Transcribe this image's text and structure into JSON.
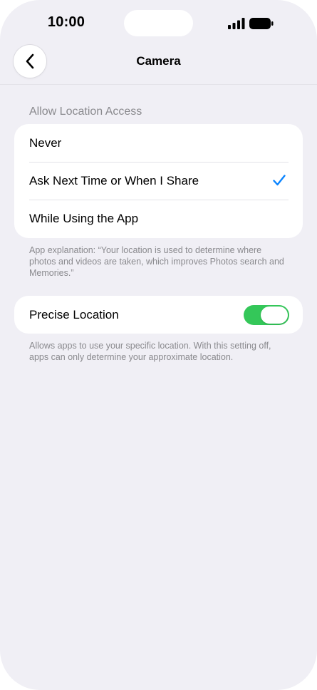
{
  "status_bar": {
    "time": "10:00"
  },
  "nav": {
    "title": "Camera",
    "back_icon": "chevron-left-icon"
  },
  "location_access": {
    "header": "Allow Location Access",
    "options": [
      {
        "label": "Never",
        "selected": false
      },
      {
        "label": "Ask Next Time or When I Share",
        "selected": true
      },
      {
        "label": "While Using the App",
        "selected": false
      }
    ],
    "explanation": "App explanation: “Your location is used to determine where photos and videos are taken, which improves Photos search and Memories.”"
  },
  "precise_location": {
    "label": "Precise Location",
    "enabled": true,
    "description": "Allows apps to use your specific location. With this setting off, apps can only determine your approximate location."
  },
  "colors": {
    "background": "#f0eff5",
    "accent_blue": "#0a84ff",
    "toggle_on": "#34c759",
    "secondary_text": "#8a8a8e"
  }
}
